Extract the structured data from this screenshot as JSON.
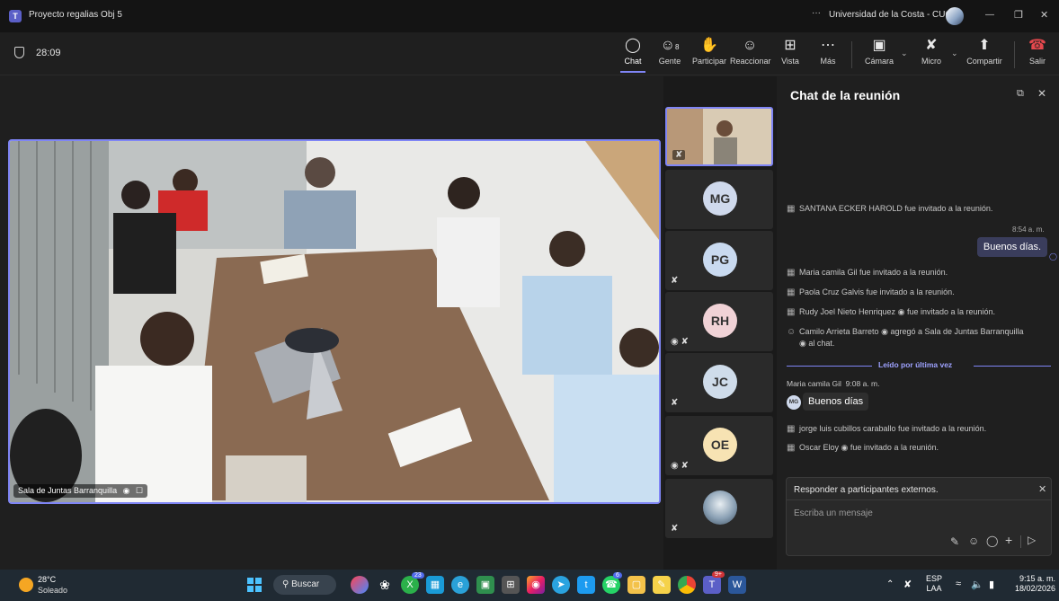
{
  "titlebar": {
    "app_title": "Proyecto regalias Obj 5",
    "org": "Universidad de la Costa - CUC",
    "more": "···",
    "minimize": "—",
    "restore": "❐",
    "close": "✕"
  },
  "toolbar": {
    "timer": "28:09",
    "chat": "Chat",
    "people": "Gente",
    "people_count": "8",
    "raise": "Participar",
    "react": "Reaccionar",
    "view": "Vista",
    "more": "Más",
    "camera": "Cámara",
    "mic": "Micro",
    "share": "Compartir",
    "leave": "Salir"
  },
  "main_video": {
    "label": "Sala de Juntas Barranquilla"
  },
  "tiles": [
    {
      "initials": "",
      "color": "#c9b69a"
    },
    {
      "initials": "MG",
      "color": "#cfd9ec"
    },
    {
      "initials": "PG",
      "color": "#c9daf0"
    },
    {
      "initials": "RH",
      "color": "#f0d2d6"
    },
    {
      "initials": "JC",
      "color": "#cfdcea"
    },
    {
      "initials": "OE",
      "color": "#f7e3b3"
    },
    {
      "initials": "",
      "color": "#9fb0bf"
    }
  ],
  "chat": {
    "title": "Chat de la reunión",
    "msg1": "SANTANA ECKER HAROLD fue invitado a la reunión.",
    "own_time": "8:54 a. m.",
    "own_msg": "Buenos días.",
    "msg2": "Maria camila Gil fue invitado a la reunión.",
    "msg3": "Paola Cruz Galvis fue invitado a la reunión.",
    "msg4": "Rudy Joel Nieto Henriquez",
    "msg4b": "fue invitado a la reunión.",
    "msg5": "Camilo Arrieta Barreto",
    "msg5b": "agregó a Sala de Juntas Barranquilla",
    "msg5c": "al chat.",
    "divider": "Leído por última vez",
    "sender": "Maria camila Gil",
    "sender_time": "9:08 a. m.",
    "sender_initials": "MG",
    "sender_msg": "Buenos días",
    "msg6": "jorge luis cubillos caraballo fue invitado a la reunión.",
    "msg7": "Oscar Eloy",
    "msg7b": "fue invitado a la reunión.",
    "reply_header": "Responder a participantes externos.",
    "input_placeholder": "Escriba un mensaje"
  },
  "taskbar": {
    "temp": "28°C",
    "weather": "Soleado",
    "search": "Buscar",
    "lang1": "ESP",
    "lang2": "LAA",
    "time": "9:15 a. m.",
    "date": "18/02/2026",
    "badge_edge": "23",
    "badge_teams": "9+",
    "badge_whatsapp": "6"
  }
}
